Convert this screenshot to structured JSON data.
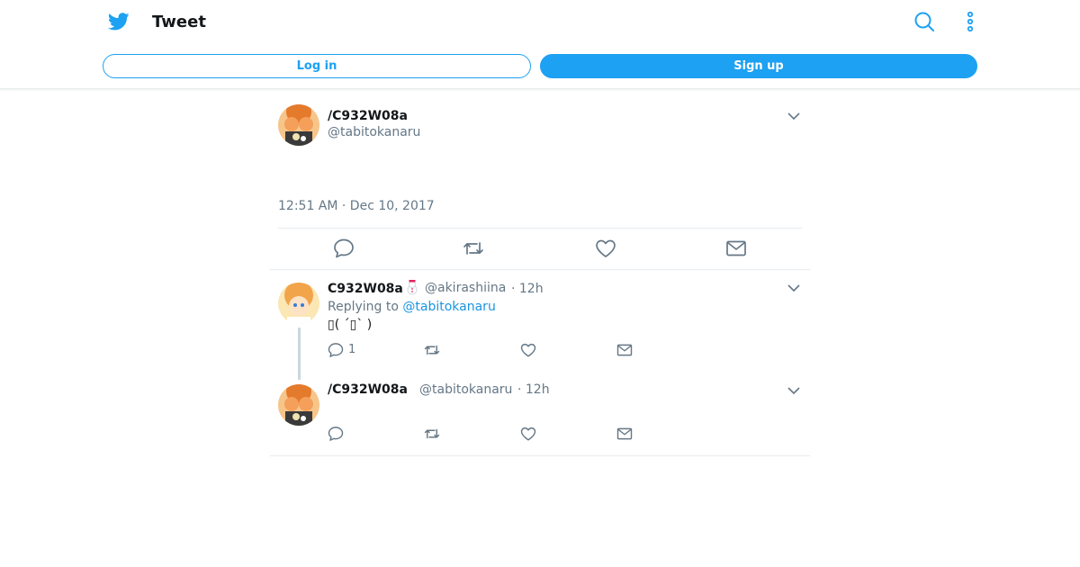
{
  "header": {
    "title": "Tweet",
    "login_label": "Log in",
    "signup_label": "Sign up",
    "icons": [
      "twitter-bird-icon",
      "search-icon",
      "more-vertical-icon"
    ],
    "accent_color": "#1da1f2"
  },
  "tweet": {
    "name": "/C932W08a",
    "handle": "@tabitokanaru",
    "timestamp": "12:51 AM · Dec 10, 2017",
    "actions": [
      "reply-icon",
      "retweet-icon",
      "like-icon",
      "message-icon"
    ]
  },
  "replies": [
    {
      "name": "C932W08a",
      "handle": "@akirashiina",
      "time": "· 12h",
      "replying_prefix": "Replying to",
      "replying_to": "@tabitokanaru",
      "text": "▯( ´▯` )",
      "reply_count": "1"
    },
    {
      "name": "/C932W08a",
      "handle": "@tabitokanaru",
      "time": "· 12h"
    }
  ]
}
